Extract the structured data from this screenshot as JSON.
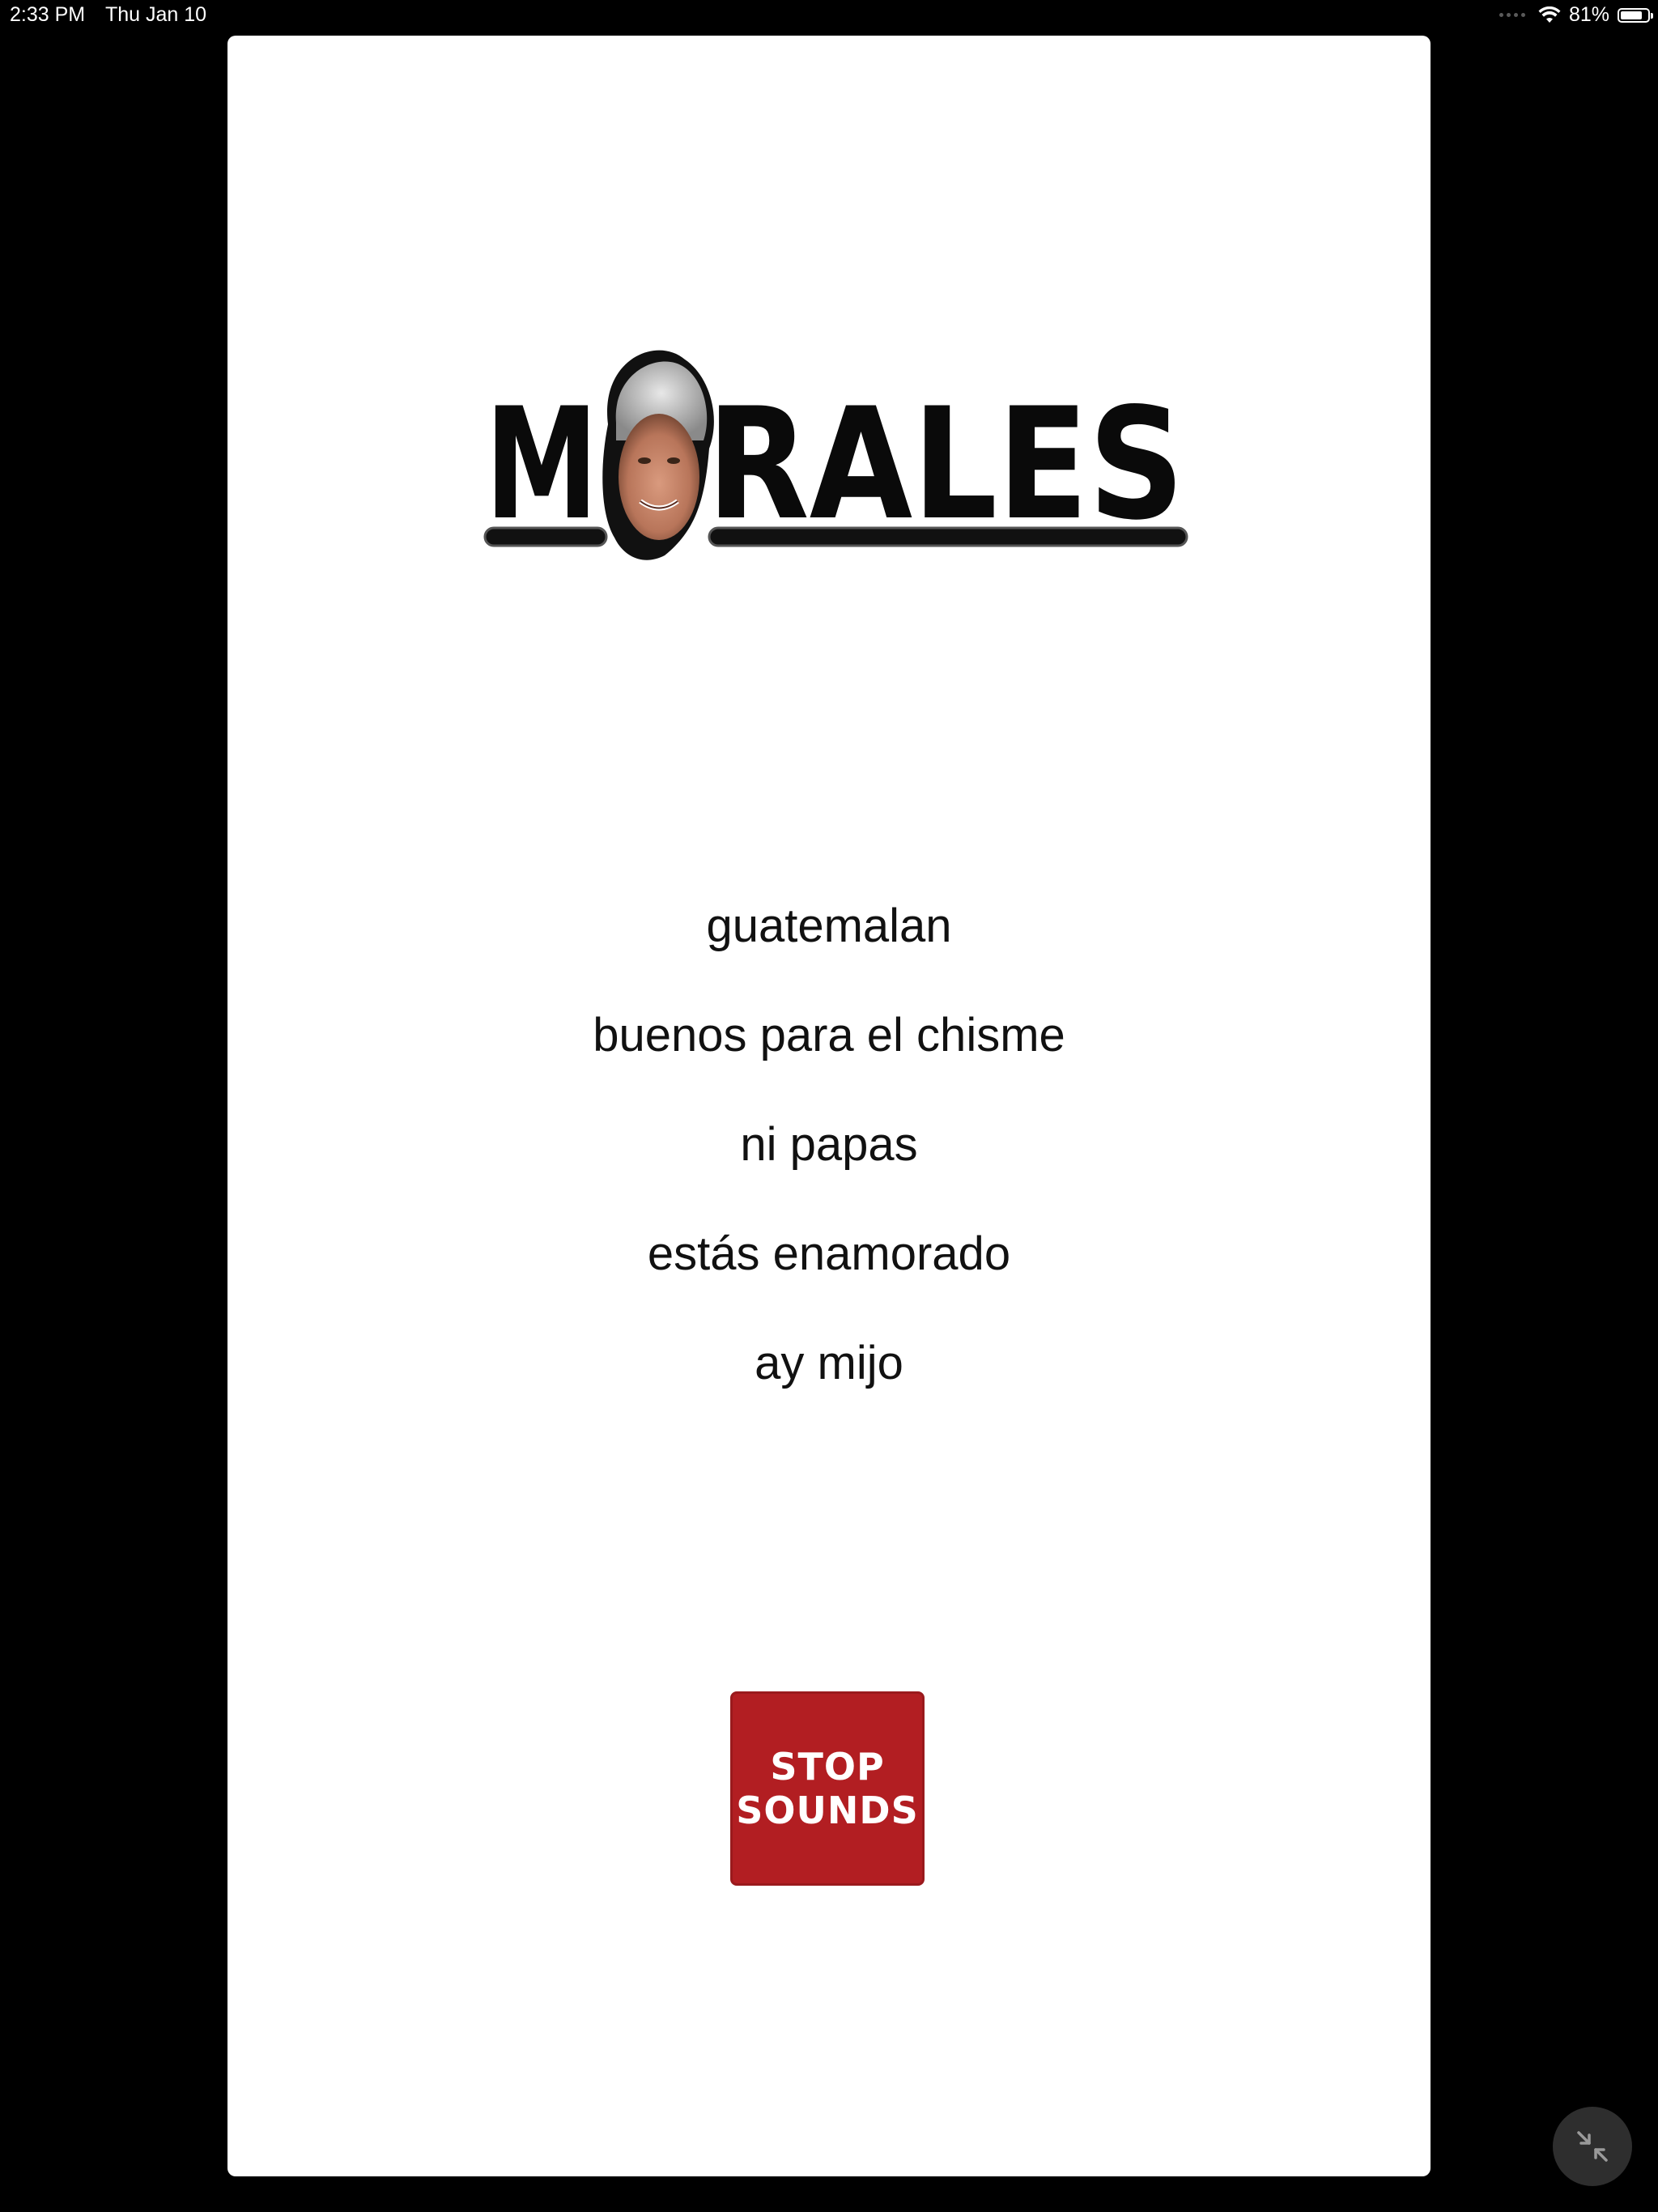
{
  "status_bar": {
    "time": "2:33 PM",
    "date": "Thu Jan 10",
    "battery_percent_label": "81%",
    "battery_level": 0.81,
    "icons": [
      "cellular-dots-icon",
      "wifi-icon",
      "battery-icon"
    ]
  },
  "logo": {
    "text": "MORALES",
    "text_before_face": "M",
    "text_after_face": "RALES",
    "icon": "face-photo-logo"
  },
  "phrases": [
    {
      "label": "guatemalan"
    },
    {
      "label": "buenos para el chisme"
    },
    {
      "label": "ni papas"
    },
    {
      "label": "estás enamorado"
    },
    {
      "label": "ay mijo"
    }
  ],
  "stop_button": {
    "line1": "STOP",
    "line2": "SOUNDS",
    "color": "#b21e22"
  },
  "minimize_button": {
    "icon": "exit-fullscreen-icon"
  },
  "colors": {
    "background": "#000000",
    "card": "#ffffff",
    "text": "#111111"
  }
}
